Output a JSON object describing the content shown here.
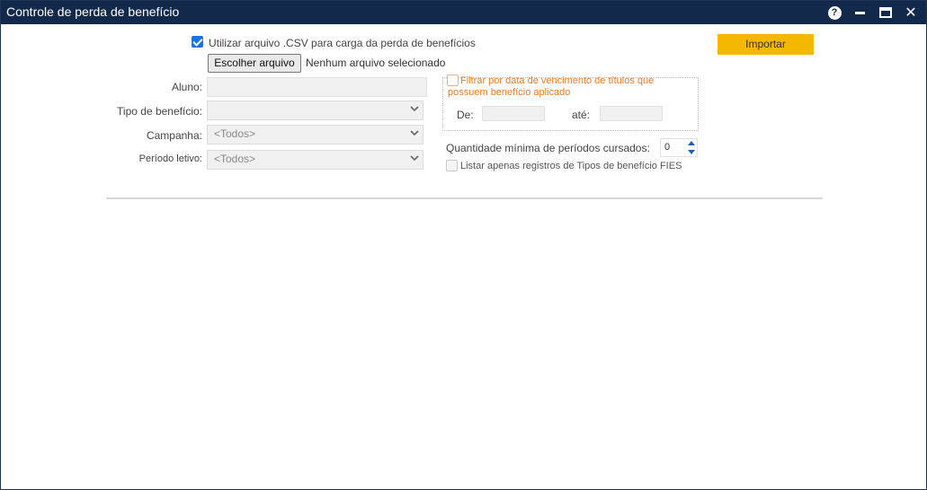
{
  "window": {
    "title": "Controle de perda de benefício",
    "controls": {
      "help": "?",
      "close": "✕"
    }
  },
  "csv": {
    "checkbox_label": "Utilizar arquivo .CSV para carga da perda de benefícios",
    "checked": true,
    "file_button": "Escolher arquivo",
    "file_status": "Nenhum arquivo selecionado"
  },
  "import_button": "Importar",
  "form": {
    "aluno_label": "Aluno:",
    "aluno_value": "",
    "tipo_label": "Tipo de benefício:",
    "tipo_value": "",
    "campanha_label": "Campanha:",
    "campanha_value": "<Todos>",
    "periodo_label": "Período letivo:",
    "periodo_value": "<Todos>"
  },
  "filter": {
    "checkbox_label": "Filtrar por data de vencimento de títulos que possuem benefício aplicado",
    "checked": false,
    "de_label": "De:",
    "de_value": "",
    "ate_label": "até:",
    "ate_value": ""
  },
  "periodos": {
    "label": "Quantidade mínima de períodos cursados:",
    "value": "0"
  },
  "fies": {
    "checkbox_label": "Listar apenas registros de Tipos de benefício FIES",
    "checked": false
  },
  "colors": {
    "titlebar": "#13294b",
    "accent": "#1a73e8",
    "import": "#f5b800",
    "orange_text": "#f07a20"
  }
}
